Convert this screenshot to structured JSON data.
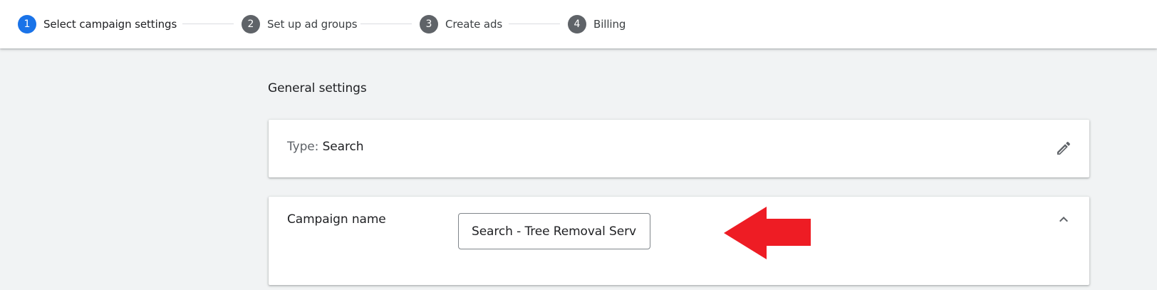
{
  "stepper": {
    "steps": [
      {
        "number": "1",
        "label": "Select campaign settings",
        "active": true
      },
      {
        "number": "2",
        "label": "Set up ad groups",
        "active": false
      },
      {
        "number": "3",
        "label": "Create ads",
        "active": false
      },
      {
        "number": "4",
        "label": "Billing",
        "active": false
      }
    ]
  },
  "main": {
    "section_title": "General settings",
    "type_card": {
      "key": "Type:",
      "value": "Search",
      "edit_icon": "pencil-icon"
    },
    "campaign_card": {
      "label": "Campaign name",
      "input_value": "Search - Tree Removal Services",
      "collapse_icon": "chevron-up-icon"
    },
    "annotation": {
      "arrow_icon": "red-arrow-left-icon",
      "arrow_color": "#ee1c24"
    }
  },
  "colors": {
    "accent": "#1a73e8",
    "step_inactive": "#5f6368",
    "background": "#f1f3f4"
  }
}
